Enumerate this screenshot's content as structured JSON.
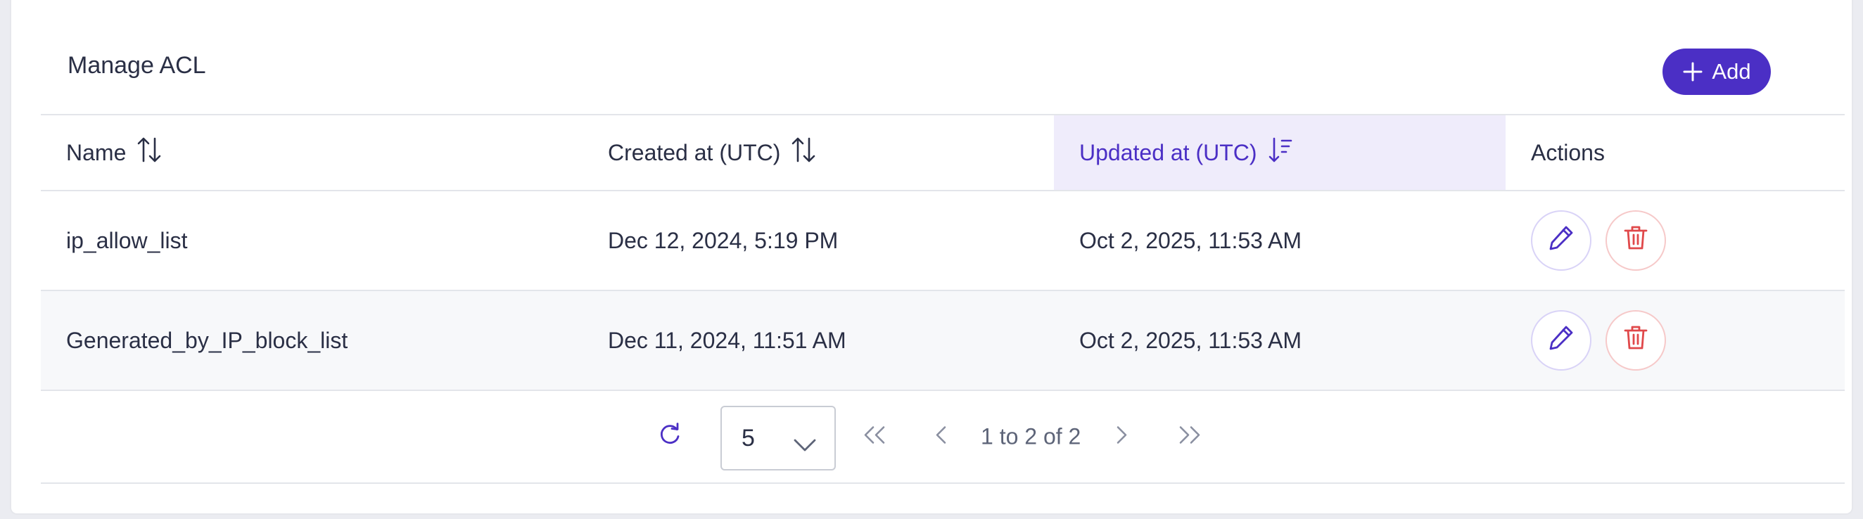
{
  "page": {
    "title": "Manage ACL",
    "add_button_label": "Add",
    "accent_color": "#4b2fc5",
    "danger_color": "#e0484a"
  },
  "table": {
    "columns": [
      {
        "label": "Name",
        "sort": "unsorted"
      },
      {
        "label": "Created at (UTC)",
        "sort": "unsorted"
      },
      {
        "label": "Updated at (UTC)",
        "sort": "descending",
        "active": true
      },
      {
        "label": "Actions"
      }
    ],
    "rows": [
      {
        "name": "ip_allow_list",
        "created": "Dec 12, 2024, 5:19 PM",
        "updated": "Oct 2, 2025, 11:53 AM"
      },
      {
        "name": "Generated_by_IP_block_list",
        "created": "Dec 11, 2024, 11:51 AM",
        "updated": "Oct 2, 2025, 11:53 AM"
      }
    ],
    "row_actions": [
      "pencil-icon",
      "trash-icon"
    ]
  },
  "pagination": {
    "page_size": "5",
    "info": "1 to 2 of 2",
    "icons": [
      "refresh-icon",
      "first-page-icon",
      "prev-page-icon",
      "next-page-icon",
      "last-page-icon"
    ]
  }
}
